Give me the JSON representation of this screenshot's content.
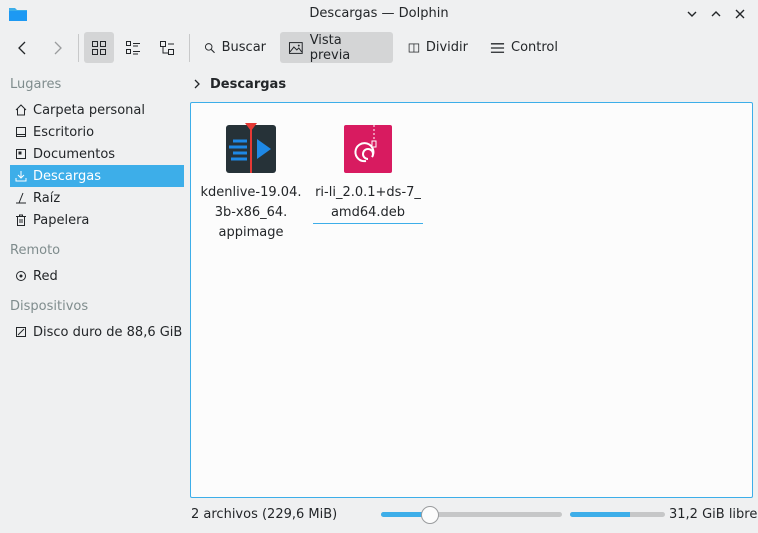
{
  "window": {
    "title": "Descargas — Dolphin"
  },
  "toolbar": {
    "search_label": "Buscar",
    "preview_label": "Vista previa",
    "split_label": "Dividir",
    "control_label": "Control"
  },
  "sidebar": {
    "places_header": "Lugares",
    "places": [
      {
        "label": "Carpeta personal",
        "icon": "home-icon"
      },
      {
        "label": "Escritorio",
        "icon": "desktop-icon"
      },
      {
        "label": "Documentos",
        "icon": "documents-icon"
      },
      {
        "label": "Descargas",
        "icon": "download-icon",
        "selected": true
      },
      {
        "label": "Raíz",
        "icon": "root-icon"
      },
      {
        "label": "Papelera",
        "icon": "trash-icon"
      }
    ],
    "remote_header": "Remoto",
    "remote": [
      {
        "label": "Red",
        "icon": "network-icon"
      }
    ],
    "devices_header": "Dispositivos",
    "devices": [
      {
        "label": "Disco duro de 88,6 GiB",
        "icon": "harddisk-icon"
      }
    ]
  },
  "breadcrumb": {
    "current": "Descargas"
  },
  "files": [
    {
      "name_lines": [
        "kdenlive-19.04.",
        "3b-x86_64.",
        "appimage"
      ],
      "icon": "kdenlive-icon"
    },
    {
      "name_lines": [
        "ri-li_2.0.1+ds-7_",
        "amd64.deb"
      ],
      "icon": "debian-package-icon"
    }
  ],
  "status": {
    "summary": "2 archivos (229,6 MiB)",
    "free_space": "31,2 GiB libre",
    "zoom_fraction": 0.27,
    "space_used_fraction": 0.63
  },
  "colors": {
    "accent": "#3daee9",
    "window_bg": "#eff0f1",
    "view_bg": "#fcfcfc"
  }
}
